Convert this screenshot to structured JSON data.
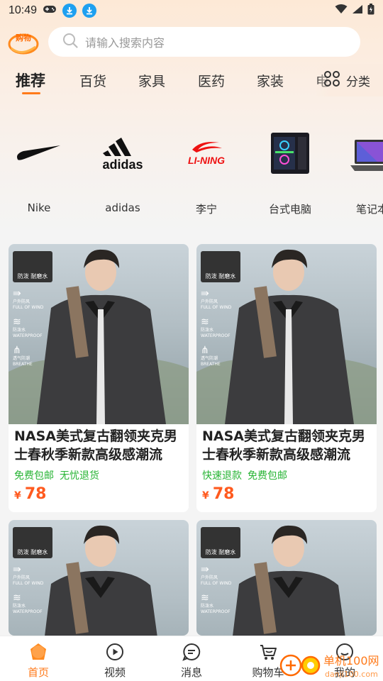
{
  "status_bar": {
    "time": "10:49"
  },
  "search": {
    "placeholder": "请输入搜索内容"
  },
  "logo": {
    "text": "购物"
  },
  "tabs": [
    {
      "label": "推荐",
      "active": true
    },
    {
      "label": "百货"
    },
    {
      "label": "家具"
    },
    {
      "label": "医药"
    },
    {
      "label": "家装"
    },
    {
      "label": "电"
    }
  ],
  "more_categories": {
    "label": "分类"
  },
  "brands": [
    {
      "name": "Nike",
      "icon": "nike-swoosh"
    },
    {
      "name": "adidas",
      "icon": "adidas-logo"
    },
    {
      "name": "李宁",
      "icon": "li-ning-logo"
    },
    {
      "name": "台式电脑",
      "icon": "desktop-pc"
    },
    {
      "name": "笔记本",
      "icon": "laptop"
    }
  ],
  "badge": {
    "top": "防泼 耐磨水",
    "features": [
      "户外防风\nFULL OF WIND",
      "防泼水\nWATERPROOF",
      "透气防潮\nBREATHE"
    ]
  },
  "products": [
    {
      "title": "NASA美式复古翻领夹克男士春秋季新款高级感潮流",
      "tags": [
        "免费包邮",
        "无忧退货"
      ],
      "currency": "¥",
      "price": "78"
    },
    {
      "title": "NASA美式复古翻领夹克男士春秋季新款高级感潮流",
      "tags": [
        "快速退款",
        "免费包邮"
      ],
      "currency": "¥",
      "price": "78"
    },
    {
      "title": "",
      "tags": [],
      "currency": "",
      "price": ""
    },
    {
      "title": "",
      "tags": [],
      "currency": "",
      "price": ""
    }
  ],
  "bottom_nav": [
    {
      "label": "首页",
      "icon": "home-icon",
      "active": true
    },
    {
      "label": "视频",
      "icon": "video-icon"
    },
    {
      "label": "消息",
      "icon": "message-icon"
    },
    {
      "label": "购物车",
      "icon": "cart-icon"
    },
    {
      "label": "我的",
      "icon": "profile-icon"
    }
  ],
  "watermark": {
    "text": "单机100网",
    "url": "danji100.com"
  },
  "colors": {
    "accent": "#ff7a1a",
    "price": "#ff5a1f",
    "tag_green": "#27b434"
  }
}
